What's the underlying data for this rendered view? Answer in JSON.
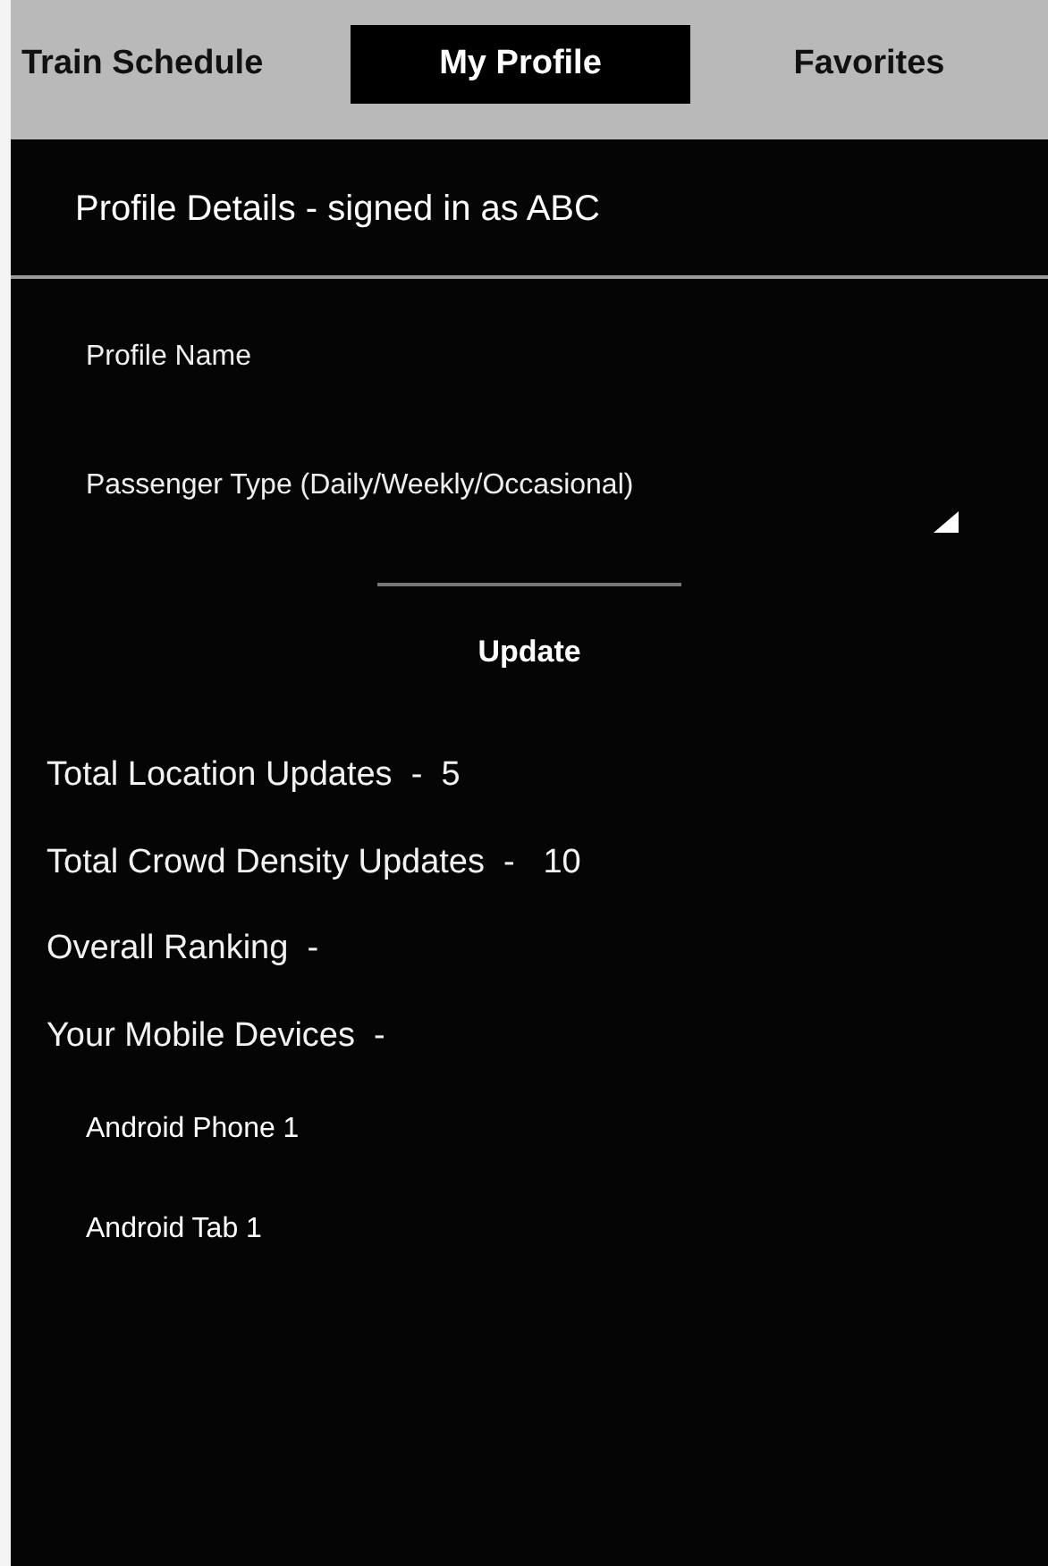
{
  "tabs": [
    {
      "label": "Train Schedule",
      "selected": false
    },
    {
      "label": "My Profile",
      "selected": true
    },
    {
      "label": "Favorites",
      "selected": false
    }
  ],
  "header": {
    "title": "Profile Details - signed in as ABC"
  },
  "form": {
    "profile_name": {
      "placeholder": "Profile Name"
    },
    "passenger_type": {
      "placeholder": "Passenger Type (Daily/Weekly/Occasional)"
    },
    "button": "Update"
  },
  "stats": [
    "Total Location Updates  -  5",
    "Total Crowd Density Updates  -   10",
    "Overall Ranking  -",
    "Your Mobile Devices  -"
  ],
  "devices": [
    "Android Phone 1",
    "Android Tab 1"
  ]
}
